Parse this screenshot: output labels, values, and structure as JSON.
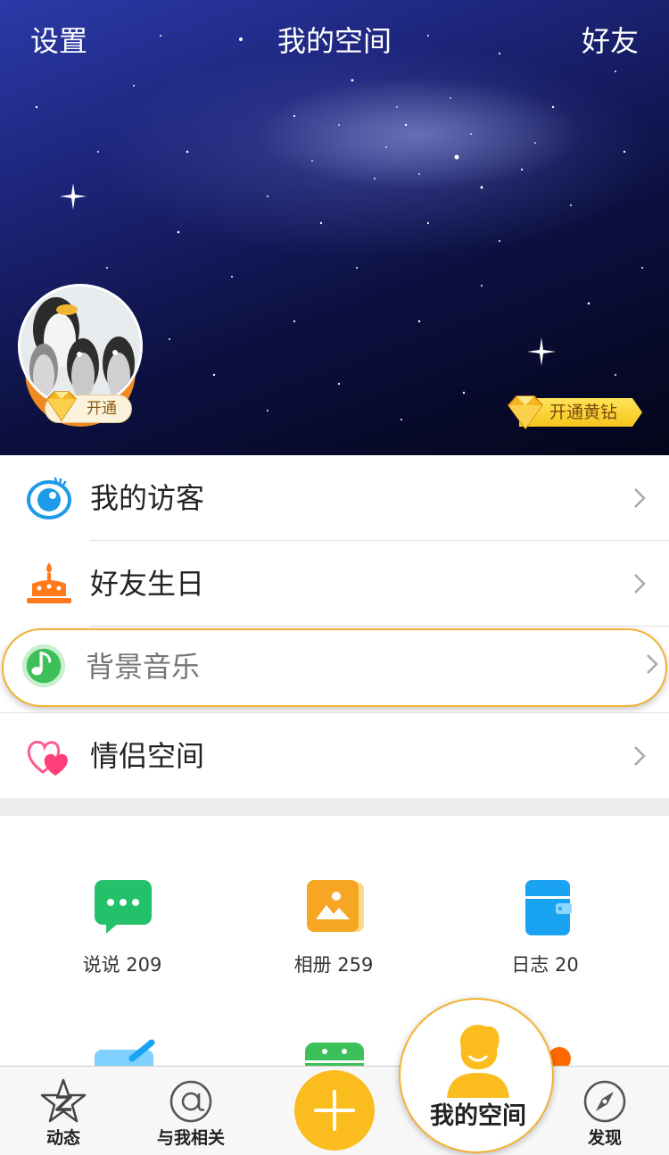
{
  "header": {
    "left_label": "设置",
    "title": "我的空间",
    "right_label": "好友"
  },
  "profile": {
    "vip_badge_label": "开通",
    "yellow_diamond_label": "开通黄钻"
  },
  "menu": {
    "items": [
      {
        "label": "我的访客",
        "icon": "eye-icon"
      },
      {
        "label": "好友生日",
        "icon": "birthday-cake-icon"
      },
      {
        "label": "背景音乐",
        "icon": "music-note-icon"
      },
      {
        "label": "情侣空间",
        "icon": "hearts-icon"
      }
    ]
  },
  "grid": {
    "items": [
      {
        "label": "说说 209",
        "icon": "chat-bubble-icon"
      },
      {
        "label": "相册 259",
        "icon": "photo-album-icon"
      },
      {
        "label": "日志 20",
        "icon": "diary-icon"
      }
    ]
  },
  "tabbar": {
    "items": [
      {
        "label": "动态",
        "icon": "star-z-icon"
      },
      {
        "label": "与我相关",
        "icon": "at-icon"
      },
      {
        "label": "",
        "icon": "plus-icon"
      },
      {
        "label": "我的空间",
        "icon": "person-icon"
      },
      {
        "label": "发现",
        "icon": "compass-icon"
      }
    ]
  },
  "colors": {
    "accent_yellow": "#fbbd1e",
    "highlight_border": "#f2b234",
    "vip_orange": "#f08a22",
    "chat_green": "#22c16a",
    "album_orange": "#f6a623",
    "diary_blue": "#1aa3f0"
  }
}
